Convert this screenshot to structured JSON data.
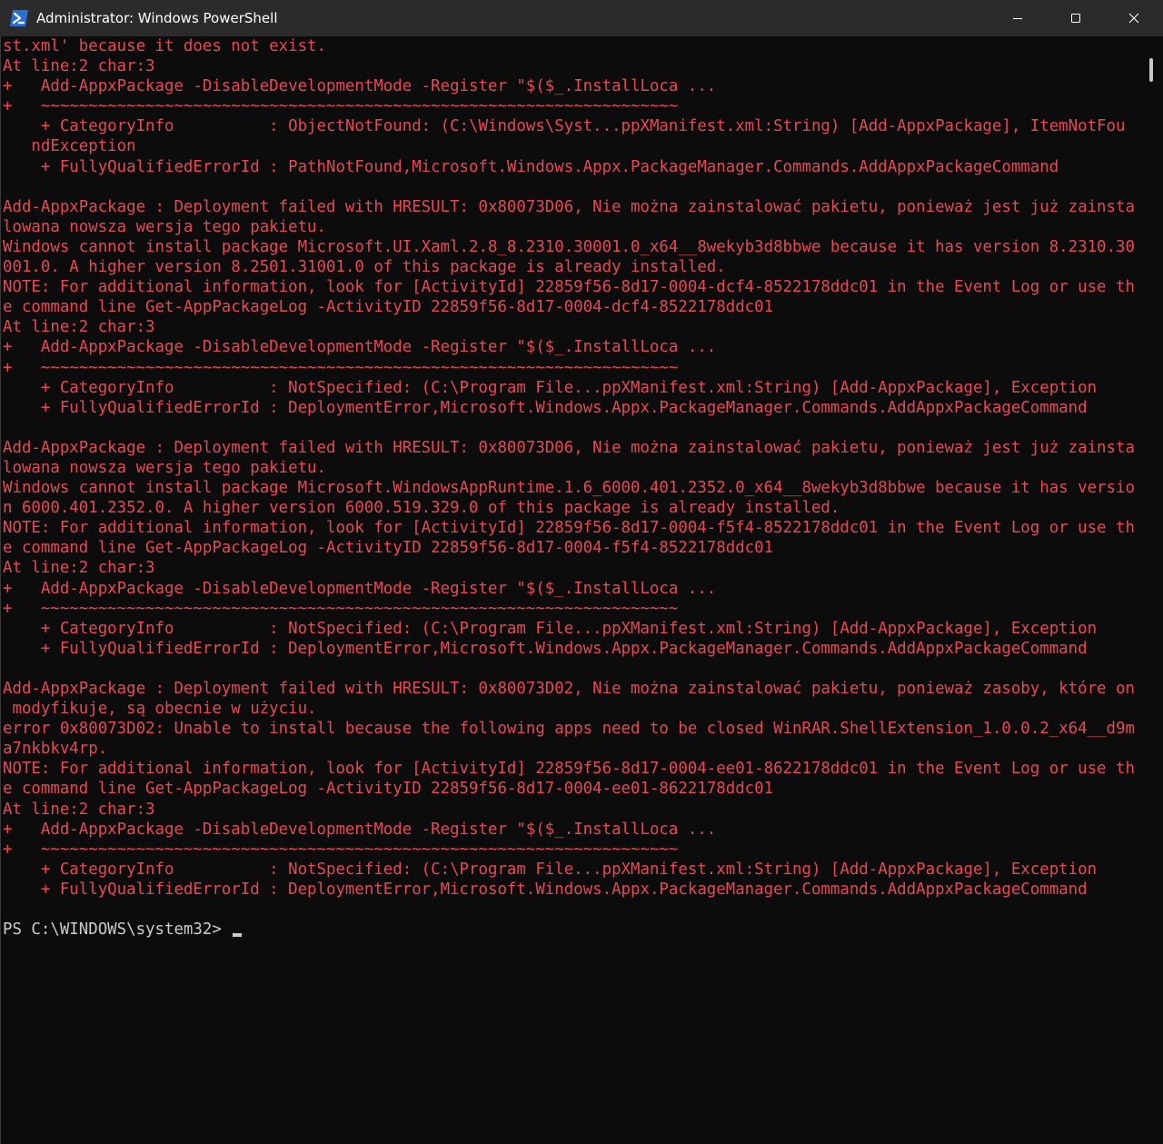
{
  "window": {
    "title": "Administrator: Windows PowerShell",
    "icon": "powershell-icon",
    "controls": [
      "minimize-icon",
      "maximize-icon",
      "close-icon"
    ]
  },
  "colors": {
    "background": "#0c0c0c",
    "error_text": "#e74856",
    "normal_text": "#cccccc",
    "titlebar": "#2b2b2b"
  },
  "console": {
    "lines": [
      "st.xml' because it does not exist.",
      "At line:2 char:3",
      "+   Add-AppxPackage -DisableDevelopmentMode -Register \"$($_.InstallLoca ...",
      "+   ~~~~~~~~~~~~~~~~~~~~~~~~~~~~~~~~~~~~~~~~~~~~~~~~~~~~~~~~~~~~~~~~~~~",
      "    + CategoryInfo          : ObjectNotFound: (C:\\Windows\\Syst...ppXManifest.xml:String) [Add-AppxPackage], ItemNotFou",
      "   ndException",
      "    + FullyQualifiedErrorId : PathNotFound,Microsoft.Windows.Appx.PackageManager.Commands.AddAppxPackageCommand",
      "",
      "Add-AppxPackage : Deployment failed with HRESULT: 0x80073D06, Nie można zainstalować pakietu, ponieważ jest już zainsta",
      "lowana nowsza wersja tego pakietu.",
      "Windows cannot install package Microsoft.UI.Xaml.2.8_8.2310.30001.0_x64__8wekyb3d8bbwe because it has version 8.2310.30",
      "001.0. A higher version 8.2501.31001.0 of this package is already installed.",
      "NOTE: For additional information, look for [ActivityId] 22859f56-8d17-0004-dcf4-8522178ddc01 in the Event Log or use th",
      "e command line Get-AppPackageLog -ActivityID 22859f56-8d17-0004-dcf4-8522178ddc01",
      "At line:2 char:3",
      "+   Add-AppxPackage -DisableDevelopmentMode -Register \"$($_.InstallLoca ...",
      "+   ~~~~~~~~~~~~~~~~~~~~~~~~~~~~~~~~~~~~~~~~~~~~~~~~~~~~~~~~~~~~~~~~~~~",
      "    + CategoryInfo          : NotSpecified: (C:\\Program File...ppXManifest.xml:String) [Add-AppxPackage], Exception",
      "    + FullyQualifiedErrorId : DeploymentError,Microsoft.Windows.Appx.PackageManager.Commands.AddAppxPackageCommand",
      "",
      "Add-AppxPackage : Deployment failed with HRESULT: 0x80073D06, Nie można zainstalować pakietu, ponieważ jest już zainsta",
      "lowana nowsza wersja tego pakietu.",
      "Windows cannot install package Microsoft.WindowsAppRuntime.1.6_6000.401.2352.0_x64__8wekyb3d8bbwe because it has versio",
      "n 6000.401.2352.0. A higher version 6000.519.329.0 of this package is already installed.",
      "NOTE: For additional information, look for [ActivityId] 22859f56-8d17-0004-f5f4-8522178ddc01 in the Event Log or use th",
      "e command line Get-AppPackageLog -ActivityID 22859f56-8d17-0004-f5f4-8522178ddc01",
      "At line:2 char:3",
      "+   Add-AppxPackage -DisableDevelopmentMode -Register \"$($_.InstallLoca ...",
      "+   ~~~~~~~~~~~~~~~~~~~~~~~~~~~~~~~~~~~~~~~~~~~~~~~~~~~~~~~~~~~~~~~~~~~",
      "    + CategoryInfo          : NotSpecified: (C:\\Program File...ppXManifest.xml:String) [Add-AppxPackage], Exception",
      "    + FullyQualifiedErrorId : DeploymentError,Microsoft.Windows.Appx.PackageManager.Commands.AddAppxPackageCommand",
      "",
      "Add-AppxPackage : Deployment failed with HRESULT: 0x80073D02, Nie można zainstalować pakietu, ponieważ zasoby, które on",
      " modyfikuje, są obecnie w użyciu.",
      "error 0x80073D02: Unable to install because the following apps need to be closed WinRAR.ShellExtension_1.0.0.2_x64__d9m",
      "a7nkbkv4rp.",
      "NOTE: For additional information, look for [ActivityId] 22859f56-8d17-0004-ee01-8622178ddc01 in the Event Log or use th",
      "e command line Get-AppPackageLog -ActivityID 22859f56-8d17-0004-ee01-8622178ddc01",
      "At line:2 char:3",
      "+   Add-AppxPackage -DisableDevelopmentMode -Register \"$($_.InstallLoca ...",
      "+   ~~~~~~~~~~~~~~~~~~~~~~~~~~~~~~~~~~~~~~~~~~~~~~~~~~~~~~~~~~~~~~~~~~~",
      "    + CategoryInfo          : NotSpecified: (C:\\Program File...ppXManifest.xml:String) [Add-AppxPackage], Exception",
      "    + FullyQualifiedErrorId : DeploymentError,Microsoft.Windows.Appx.PackageManager.Commands.AddAppxPackageCommand",
      ""
    ],
    "prompt": "PS C:\\WINDOWS\\system32> "
  }
}
